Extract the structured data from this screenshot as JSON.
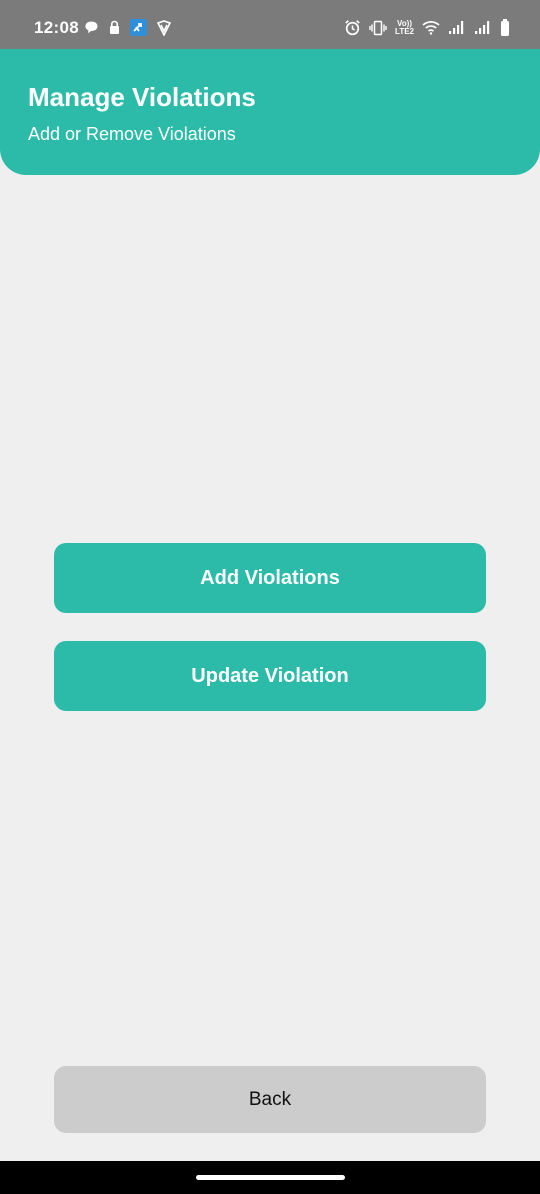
{
  "status_bar": {
    "time": "12:08",
    "network_label_top": "Vo))",
    "network_label_bottom": "LTE2",
    "left_icons": [
      "chat-bubble-icon",
      "lock-icon",
      "app-icon",
      "vpn-shield-icon"
    ],
    "right_icons": [
      "alarm-icon",
      "vibrate-icon",
      "volte-lte-icon",
      "wifi-icon",
      "signal-icon",
      "signal-icon",
      "battery-icon"
    ]
  },
  "header": {
    "title": "Manage Violations",
    "subtitle": "Add or Remove Violations",
    "color": "#2cbba8"
  },
  "actions": {
    "add_label": "Add Violations",
    "update_label": "Update Violation",
    "back_label": "Back"
  },
  "colors": {
    "accent": "#2cbba8",
    "background": "#efefef",
    "back_button": "#cccccc"
  }
}
